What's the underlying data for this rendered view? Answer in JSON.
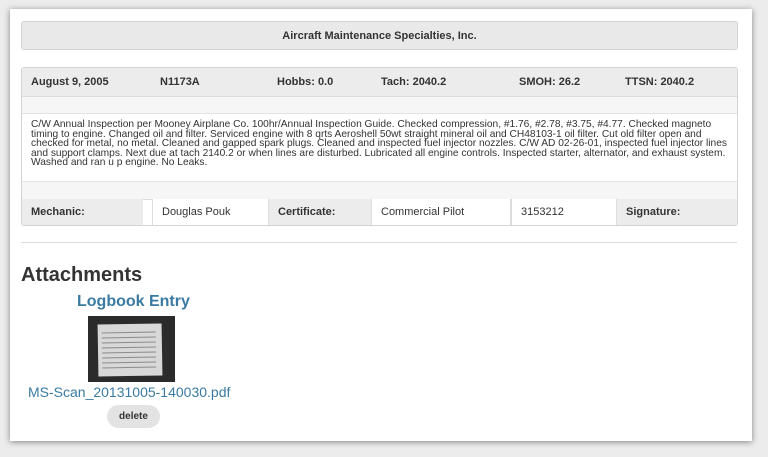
{
  "header": {
    "company": "Aircraft Maintenance Specialties, Inc."
  },
  "record": {
    "date": "August 9, 2005",
    "tail_number": "N1173A",
    "hobbs": "Hobbs: 0.0",
    "tach": "Tach: 2040.2",
    "smoh": "SMOH: 26.2",
    "ttsn": "TTSN: 2040.2",
    "description": "C/W Annual Inspection per Mooney Airplane Co. 100hr/Annual Inspection Guide. Checked compression, #1.76, #2.78, #3.75, #4.77. Checked magneto timing to engine. Changed oil and filter. Serviced engine with 8 qrts Aeroshell 50wt straight mineral oil and CH48103-1 oil filter. Cut old filter open and checked for metal, no metal. Cleaned and gapped spark plugs. Cleaned and inspected fuel injector nozzles. C/W AD 02-26-01, inspected fuel injector lines and support clamps. Next due at tach 2140.2 or when lines are disturbed. Lubricated all engine controls. Inspected starter, alternator, and exhaust system. Washed and ran u p engine. No Leaks.",
    "mechanic_label": "Mechanic:",
    "mechanic_name": "Douglas Pouk",
    "certificate_label": "Certificate:",
    "certificate_type": "Commercial Pilot",
    "certificate_number": "3153212",
    "signature_label": "Signature:"
  },
  "attachments": {
    "title": "Attachments",
    "items": [
      {
        "name": "Logbook Entry",
        "filename": "MS-Scan_20131005-140030.pdf",
        "delete_label": "delete"
      }
    ]
  }
}
